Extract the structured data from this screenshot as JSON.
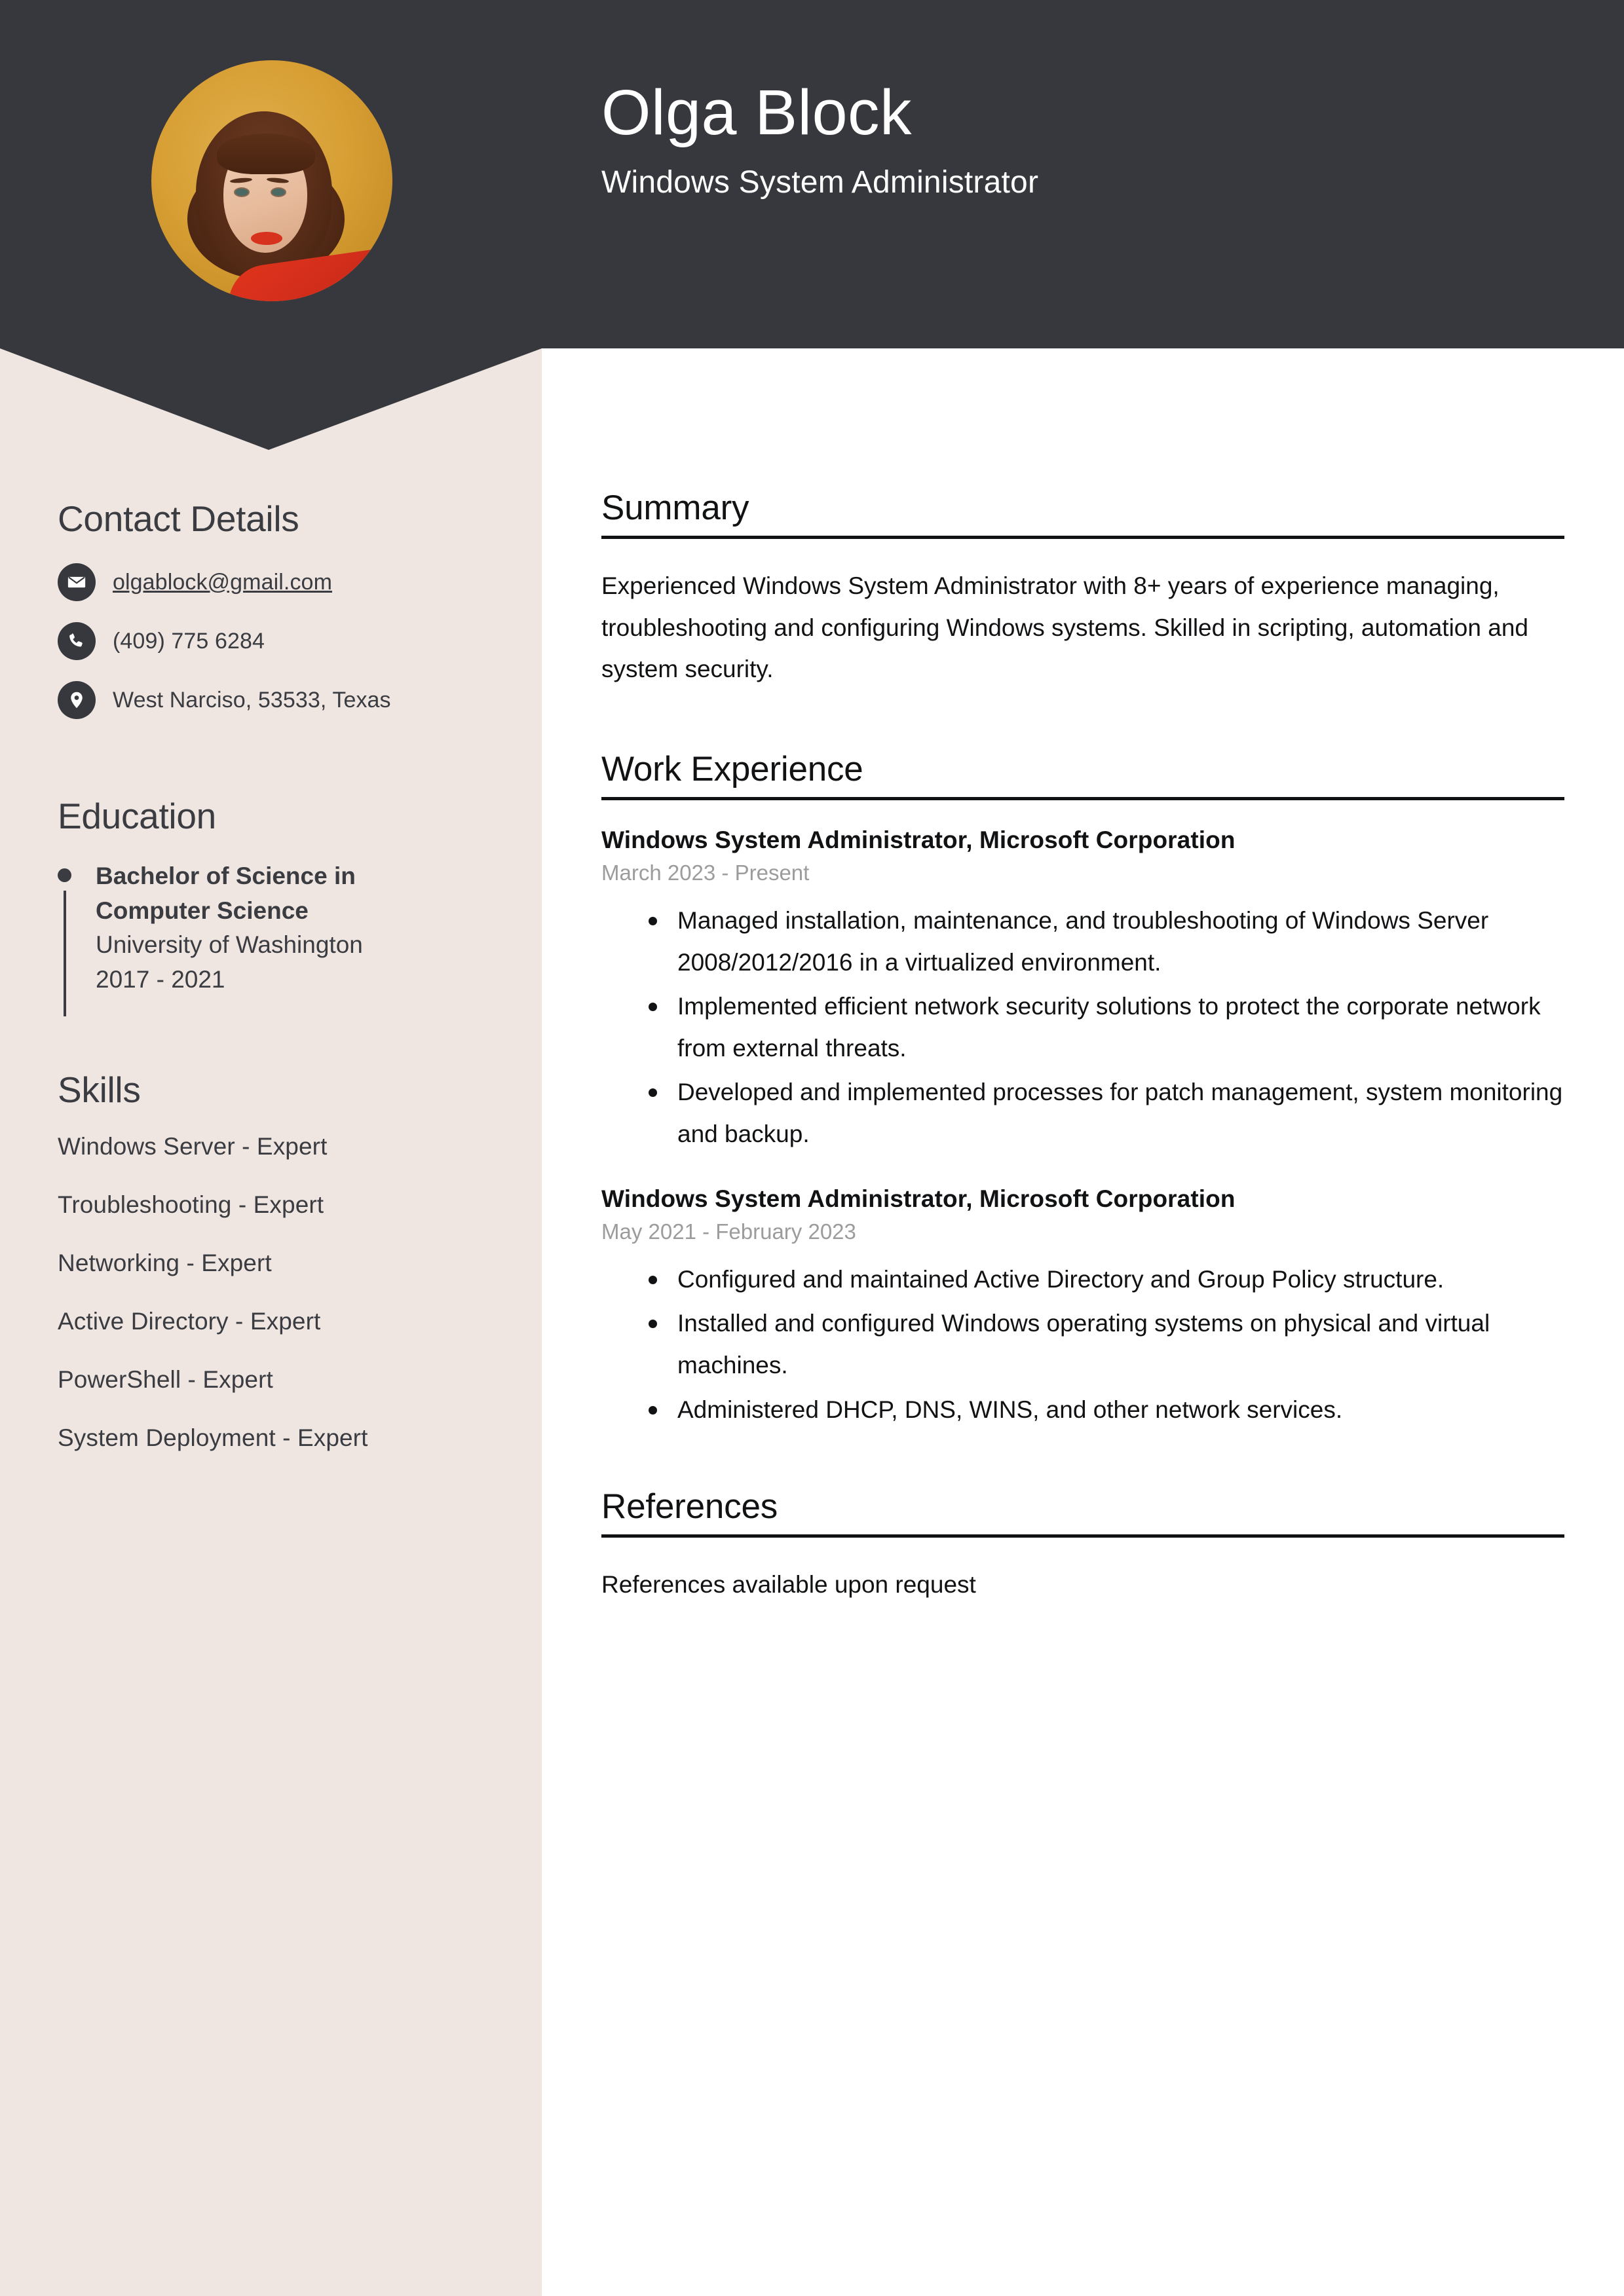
{
  "theme": {
    "header_bg": "#36383D",
    "sidebar_bg": "#EFE6E1",
    "main_bg": "#FFFFFF",
    "text_dark": "#3A3C41",
    "text_main": "#111214",
    "muted": "#9C9C9C",
    "avatar_bg": "#D79F34",
    "accent_red": "#D6321E"
  },
  "header": {
    "name": "Olga Block",
    "job_title": "Windows System Administrator",
    "avatar_alt": "portrait-photo"
  },
  "sidebar": {
    "contact": {
      "heading": "Contact Details",
      "items": [
        {
          "icon": "envelope-icon",
          "value": "olgablock@gmail.com",
          "is_link": true
        },
        {
          "icon": "phone-icon",
          "value": "(409) 775 6284",
          "is_link": false
        },
        {
          "icon": "location-pin-icon",
          "value": "West Narciso, 53533, Texas",
          "is_link": false
        }
      ]
    },
    "education": {
      "heading": "Education",
      "entries": [
        {
          "degree": "Bachelor of Science in Computer Science",
          "school": "University of Washington",
          "dates": "2017 - 2021"
        }
      ]
    },
    "skills": {
      "heading": "Skills",
      "items": [
        "Windows Server - Expert",
        "Troubleshooting - Expert",
        "Networking - Expert",
        "Active Directory - Expert",
        "PowerShell - Expert",
        "System Deployment - Expert"
      ]
    }
  },
  "main": {
    "summary": {
      "heading": "Summary",
      "text": "Experienced Windows System Administrator with 8+ years of experience managing, troubleshooting and configuring Windows systems. Skilled in scripting, automation and system security."
    },
    "work_experience": {
      "heading": "Work Experience",
      "jobs": [
        {
          "role": "Windows System Administrator, Microsoft Corporation",
          "dates": "March 2023 - Present",
          "bullets": [
            "Managed installation, maintenance, and troubleshooting of Windows Server 2008/2012/2016 in a virtualized environment.",
            "Implemented efficient network security solutions to protect the corporate network from external threats.",
            "Developed and implemented processes for patch management, system monitoring and backup."
          ]
        },
        {
          "role": "Windows System Administrator, Microsoft Corporation",
          "dates": "May 2021 - February 2023",
          "bullets": [
            "Configured and maintained Active Directory and Group Policy structure.",
            "Installed and configured Windows operating systems on physical and virtual machines.",
            "Administered DHCP, DNS, WINS, and other network services."
          ]
        }
      ]
    },
    "references": {
      "heading": "References",
      "text": "References available upon request"
    }
  }
}
